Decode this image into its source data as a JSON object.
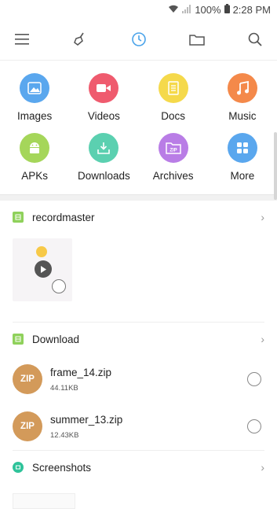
{
  "status": {
    "battery": "100%",
    "time": "2:28 PM"
  },
  "categories": [
    {
      "label": "Images",
      "color": "#5aa7ee",
      "icon": "image-icon"
    },
    {
      "label": "Videos",
      "color": "#ef5b6e",
      "icon": "video-icon"
    },
    {
      "label": "Docs",
      "color": "#f5d94b",
      "icon": "document-icon"
    },
    {
      "label": "Music",
      "color": "#f4894a",
      "icon": "music-note-icon"
    },
    {
      "label": "APKs",
      "color": "#a5d65a",
      "icon": "android-icon"
    },
    {
      "label": "Downloads",
      "color": "#5bd0b0",
      "icon": "download-icon"
    },
    {
      "label": "Archives",
      "color": "#b97de6",
      "icon": "zip-folder-icon"
    },
    {
      "label": "More",
      "color": "#5aa7ee",
      "icon": "grid-icon"
    }
  ],
  "sections": {
    "recordmaster": {
      "name": "recordmaster",
      "color": "#8fd15b"
    },
    "download": {
      "name": "Download",
      "color": "#8fd15b",
      "files": [
        {
          "name": "frame_14.zip",
          "size": "44.11KB",
          "badge": "ZIP"
        },
        {
          "name": "summer_13.zip",
          "size": "12.43KB",
          "badge": "ZIP"
        }
      ]
    },
    "screenshots": {
      "name": "Screenshots",
      "color": "#2fc39a"
    }
  }
}
